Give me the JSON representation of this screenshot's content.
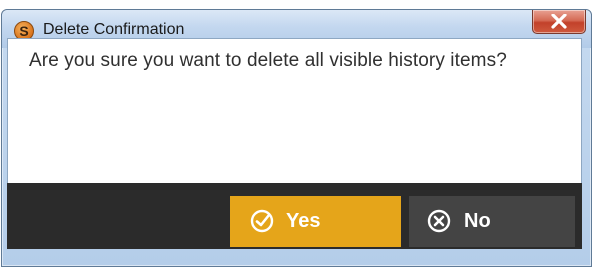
{
  "window": {
    "title": "Delete Confirmation",
    "app_icon_letter": "S",
    "close_icon": "close-x-icon"
  },
  "dialog": {
    "message": "Are you sure you want to delete all visible history items?"
  },
  "buttons": {
    "yes": {
      "label": "Yes",
      "icon": "check-circle-icon",
      "color": "#e5a51a"
    },
    "no": {
      "label": "No",
      "icon": "x-circle-icon",
      "color": "#444444"
    }
  },
  "colors": {
    "footer_bg": "#2b2b2b",
    "titlebar_bg": "#c3d7ef"
  }
}
